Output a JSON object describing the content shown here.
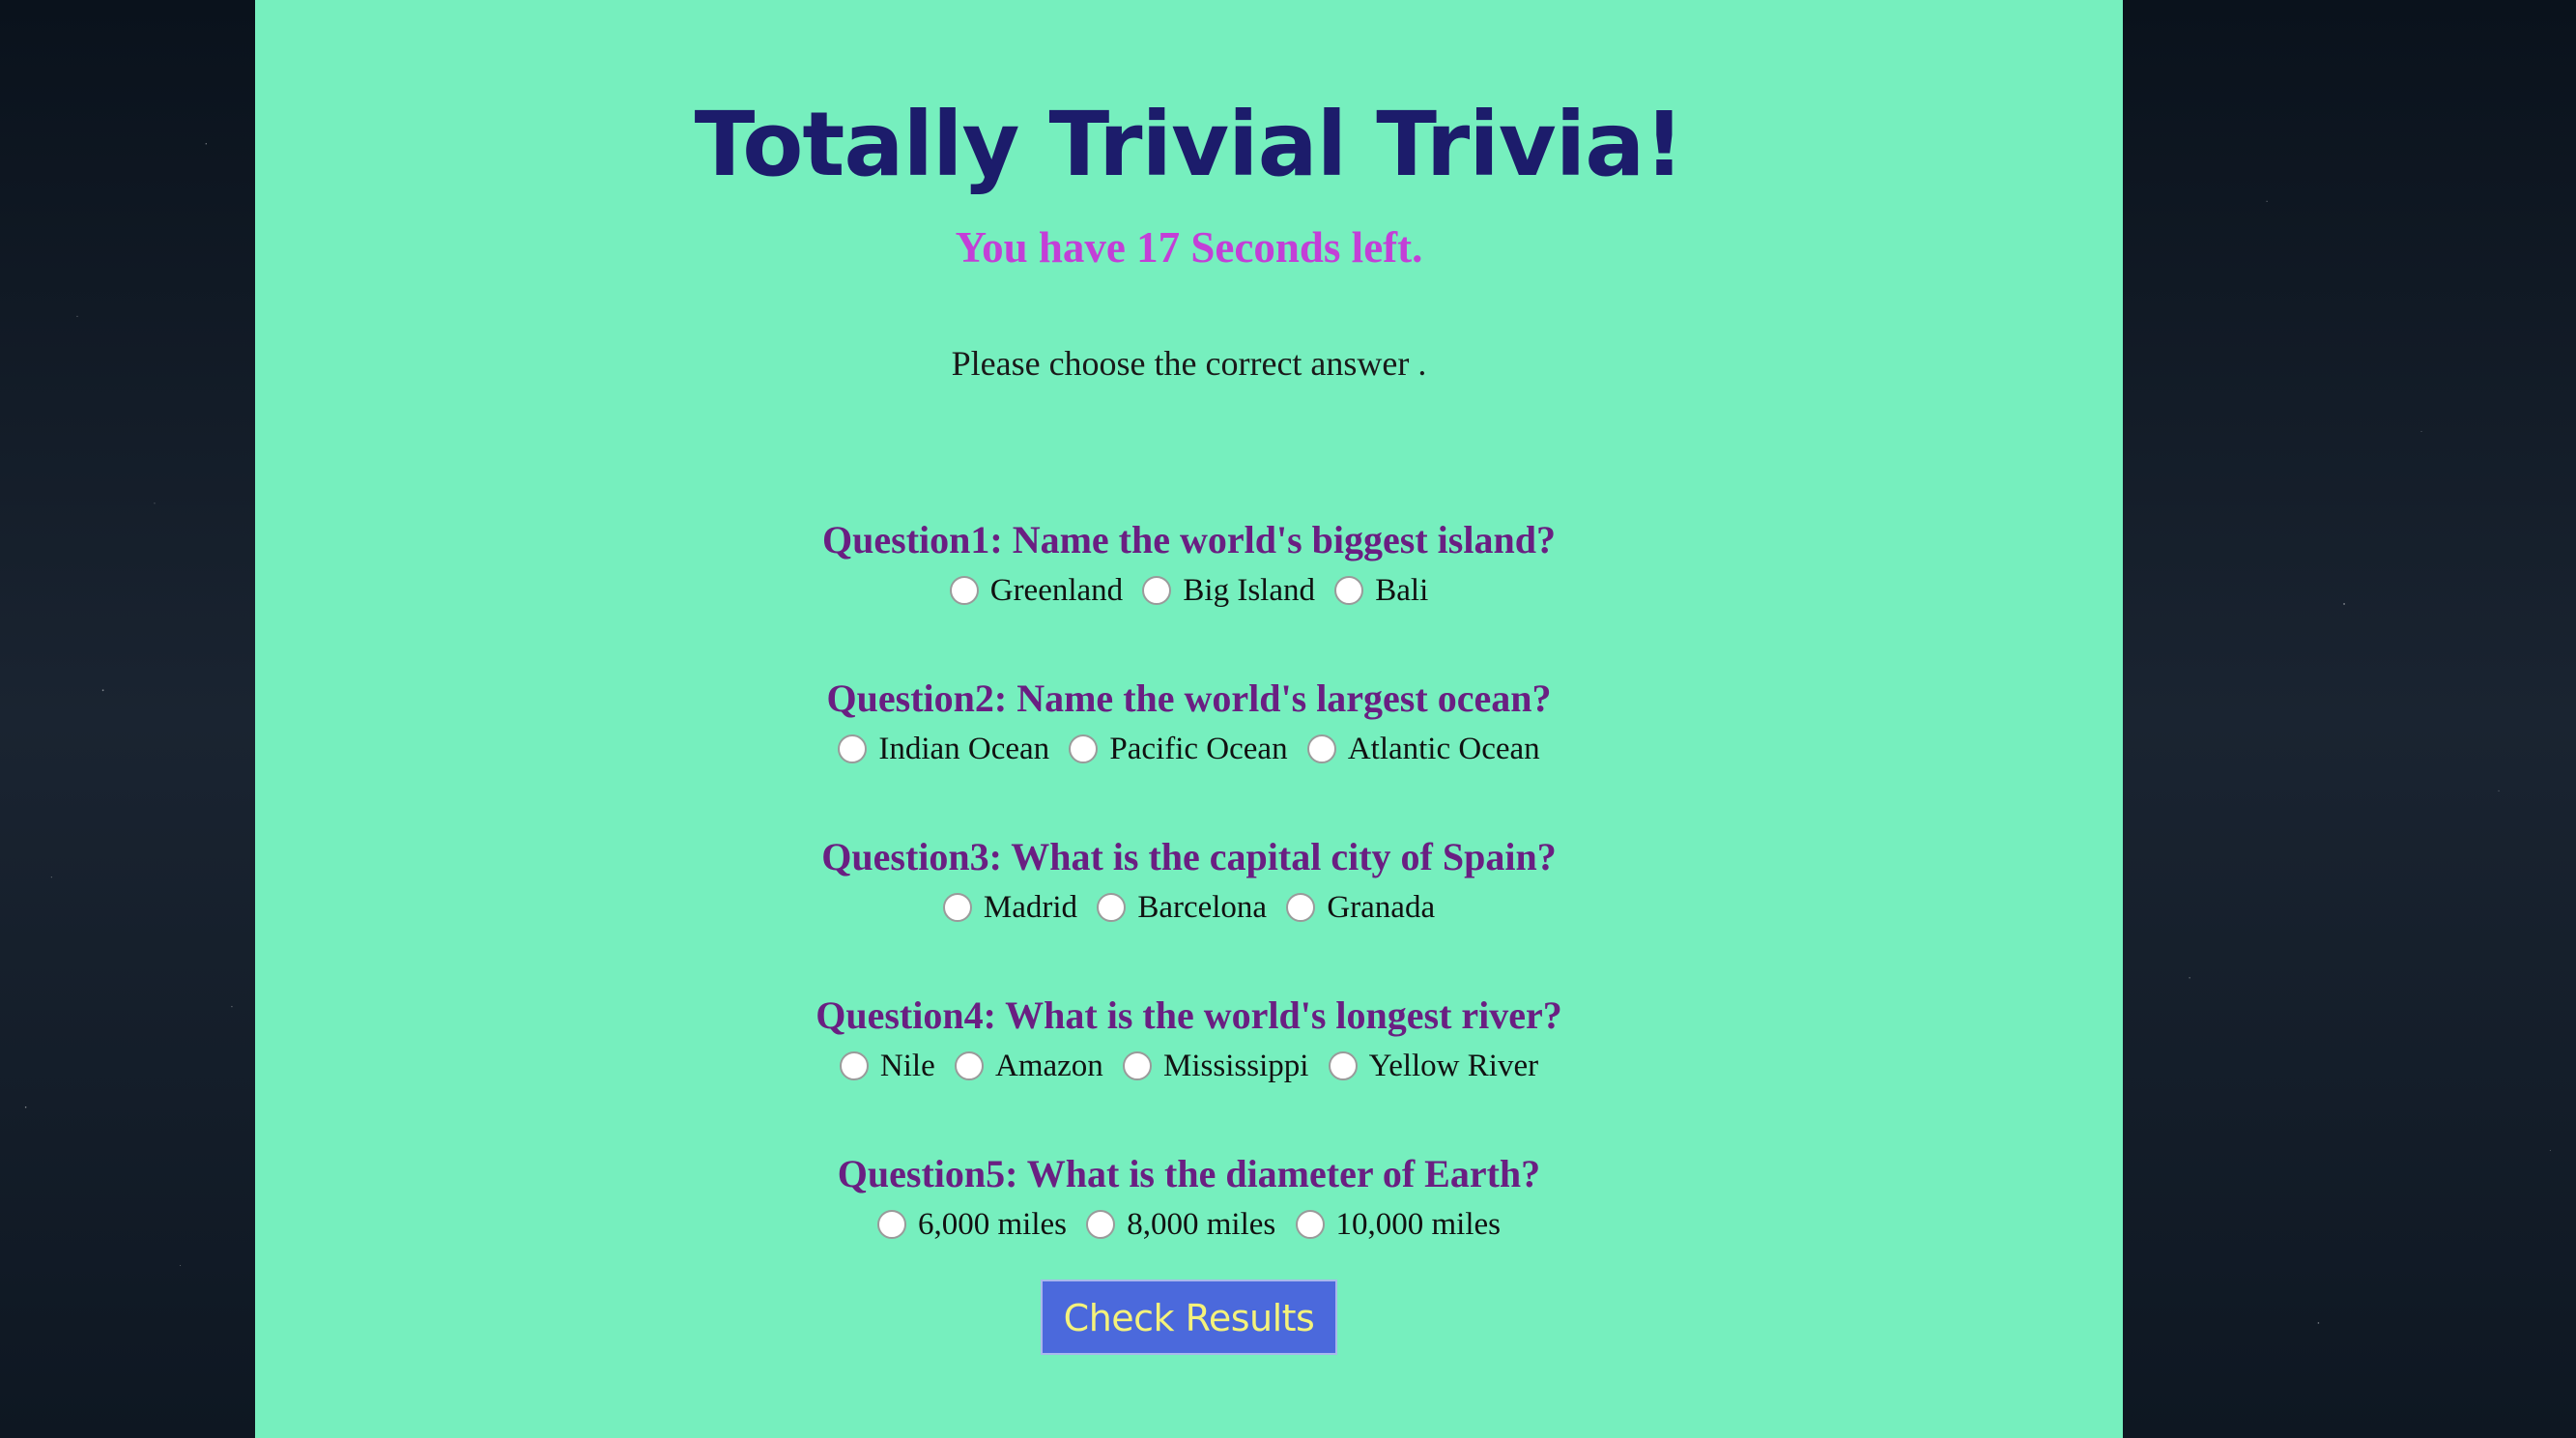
{
  "page": {
    "title": "Totally Trivial Trivia!",
    "timer_text": "You have 17 Seconds left.",
    "instruction": "Please choose the correct answer ."
  },
  "questions": [
    {
      "text": "Question1: Name the world's biggest island?",
      "options": [
        "Greenland",
        "Big Island",
        "Bali"
      ]
    },
    {
      "text": "Question2: Name the world's largest ocean?",
      "options": [
        "Indian Ocean",
        "Pacific Ocean",
        "Atlantic Ocean"
      ]
    },
    {
      "text": "Question3: What is the capital city of Spain?",
      "options": [
        "Madrid",
        "Barcelona",
        "Granada"
      ]
    },
    {
      "text": "Question4: What is the world's longest river?",
      "options": [
        "Nile",
        "Amazon",
        "Mississippi",
        "Yellow River"
      ]
    },
    {
      "text": "Question5: What is the diameter of Earth?",
      "options": [
        "6,000 miles",
        "8,000 miles",
        "10,000 miles"
      ]
    }
  ],
  "submit": {
    "label": "Check Results"
  },
  "colors": {
    "panel_background": "#76efbe",
    "title": "#1c1c6b",
    "timer": "#c33fd7",
    "question": "#6a1f82",
    "button_background": "#4b69dc",
    "button_text": "#f5f27a"
  }
}
